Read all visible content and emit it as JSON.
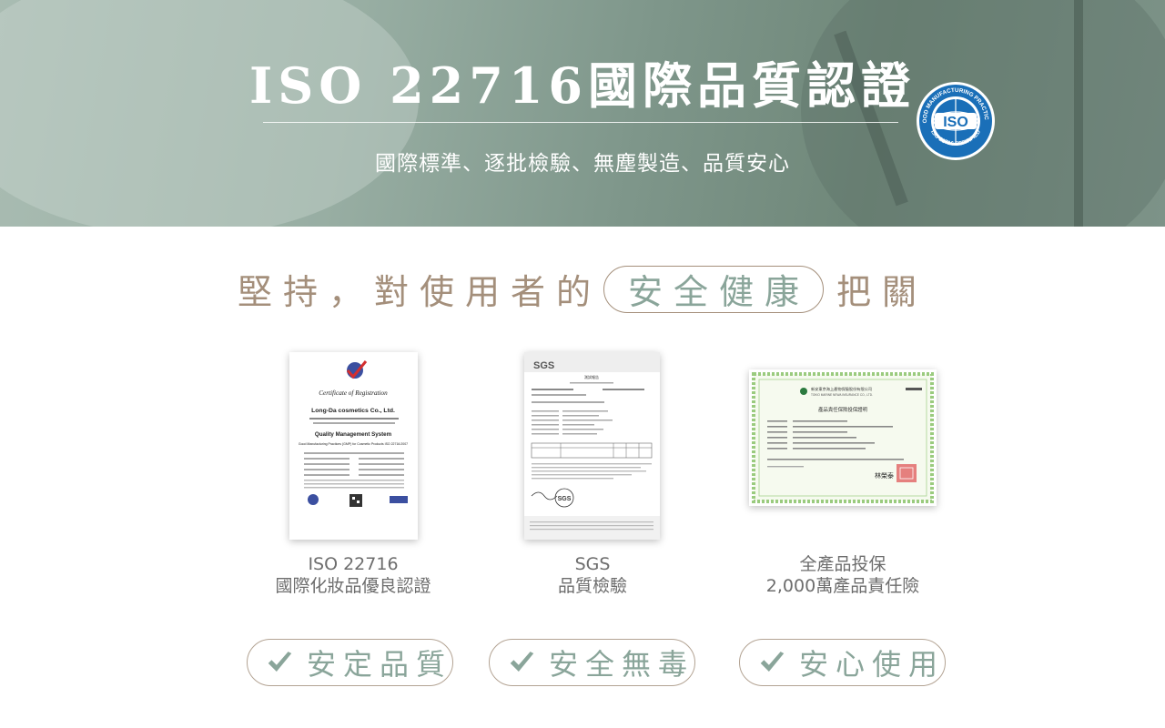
{
  "hero": {
    "title": "ISO 22716國際品質認證",
    "subtitle": "國際標準、逐批檢驗、無塵製造、品質安心",
    "badge": {
      "icon": "iso-certified-badge-icon",
      "text": "ISO",
      "ring_top": "GOOD MANUFACTURING PRACTICES",
      "ring_bottom": "ISO 22716 CERTIFIED"
    }
  },
  "headline": {
    "prefix": "堅持，對使用者的",
    "highlight": "安全健康",
    "suffix": "把關"
  },
  "certificates": [
    {
      "image_icon": "certificate-of-registration-image",
      "doc_title": "Certificate of Registration",
      "doc_company": "Long-Da cosmetics Co., Ltd.",
      "doc_system": "Quality Management System",
      "doc_scope": "Good Manufacturing Practices (GMP) for Cosmetic Products ISO 22716:2007",
      "line1": "ISO 22716",
      "line2": "國際化妝品優良認證"
    },
    {
      "image_icon": "sgs-test-report-image",
      "doc_logo": "SGS",
      "doc_title": "測試報告",
      "line1": "SGS",
      "line2": "品質檢驗"
    },
    {
      "image_icon": "product-liability-insurance-certificate-image",
      "doc_company": "新安東京海上產物保險股份有限公司",
      "doc_company_en": "TOKIO MARINE NEWA INSURANCE CO., LTD.",
      "doc_title": "產品責任保險投保證明",
      "doc_signature": "林榮泰",
      "line1": "全產品投保",
      "line2": "2,000萬產品責任險"
    }
  ],
  "features": [
    {
      "icon": "check-icon",
      "label": "安定品質"
    },
    {
      "icon": "check-icon",
      "label": "安全無毒"
    },
    {
      "icon": "check-icon",
      "label": "安心使用"
    }
  ],
  "colors": {
    "hero_bg": "#8ea498",
    "heading_brown": "#a48f7b",
    "accent_sage": "#8aa59a",
    "body_text": "#6d6d6d",
    "badge_blue": "#1a6fb8"
  }
}
